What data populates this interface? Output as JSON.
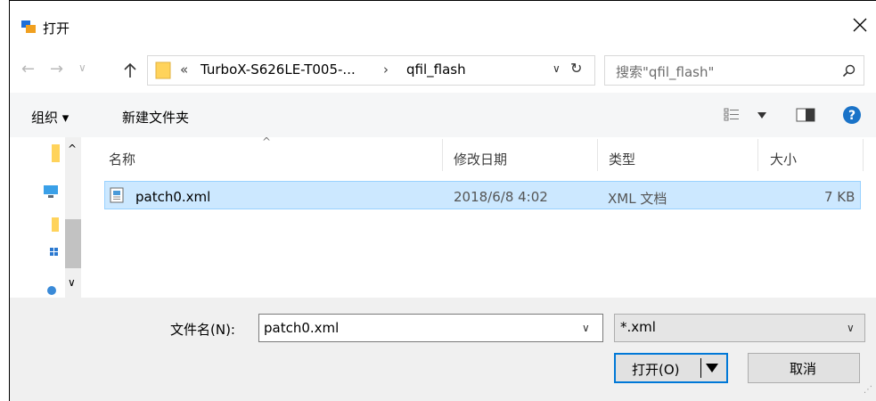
{
  "window": {
    "title": "打开"
  },
  "address": {
    "overflow": "«",
    "segment1": "TurboX-S626LE-T005-...",
    "separator": "›",
    "segment2": "qfil_flash"
  },
  "search": {
    "placeholder": "搜索\"qfil_flash\""
  },
  "commandbar": {
    "organize": "组织 ▾",
    "new_folder": "新建文件夹"
  },
  "columns": {
    "name": "名称",
    "date": "修改日期",
    "type": "类型",
    "size": "大小"
  },
  "files": [
    {
      "name": "patch0.xml",
      "date": "2018/6/8 4:02",
      "type": "XML 文档",
      "size": "7 KB"
    }
  ],
  "filename": {
    "label": "文件名(N):",
    "value": "patch0.xml"
  },
  "filetype": {
    "value": "*.xml"
  },
  "buttons": {
    "open": "打开(O)",
    "cancel": "取消"
  },
  "colors": {
    "selection": "#cce8ff",
    "selection_border": "#99d1ff",
    "accent": "#0078d7",
    "help": "#1a73c8"
  }
}
